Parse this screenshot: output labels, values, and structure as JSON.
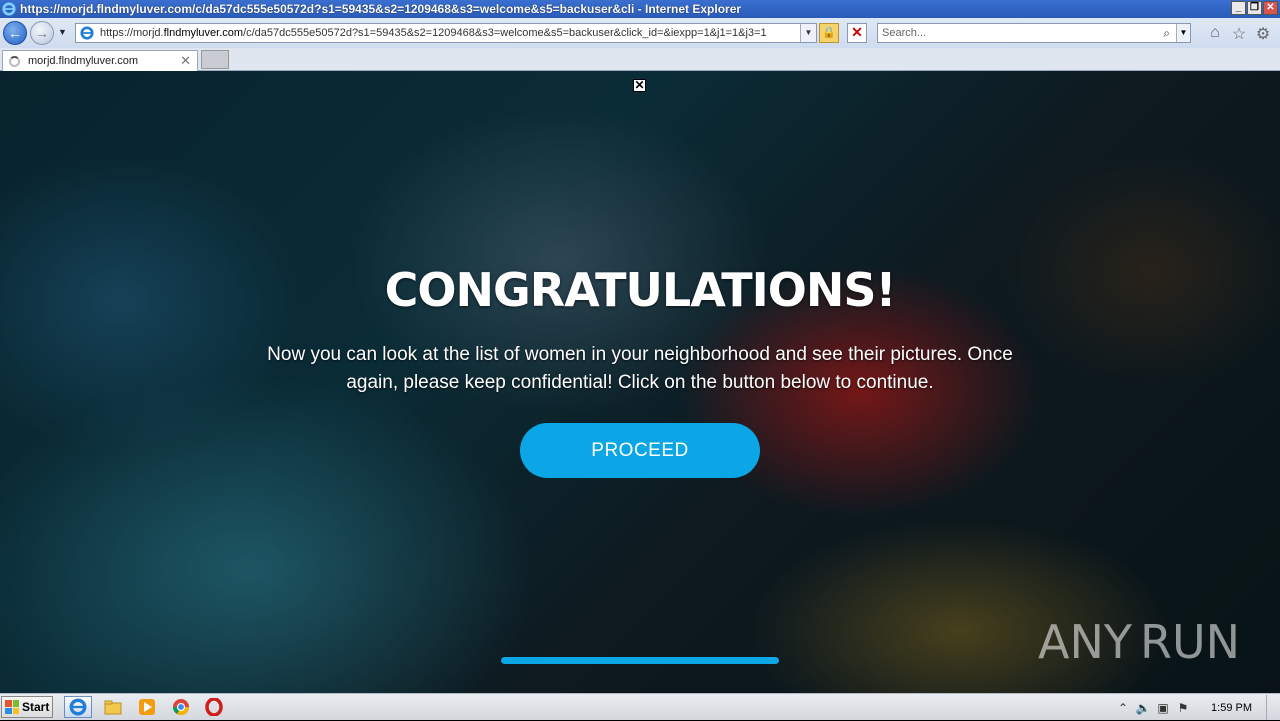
{
  "window": {
    "title": "https://morjd.flndmyluver.com/c/da57dc555e50572d?s1=59435&s2=1209468&s3=welcome&s5=backuser&cli - Internet Explorer",
    "buttons": {
      "minimize": "_",
      "maximize": "❐",
      "close": "✕"
    }
  },
  "navigation": {
    "url_prefix": "https://morjd.",
    "url_domain": "flndmyluver.com",
    "url_rest": "/c/da57dc555e50572d?s1=59435&s2=1209468&s3=welcome&s5=backuser&click_id=&iexpp=1&j1=1&j3=1",
    "search_placeholder": "Search..."
  },
  "tabs": [
    {
      "label": "morjd.flndmyluver.com",
      "loading": true
    }
  ],
  "page": {
    "close_label": "✕",
    "headline": "CONGRATULATIONS!",
    "message": "Now you can look at the list of women in your neighborhood and see their pictures. Once again, please keep confidential! Click on the button below to continue.",
    "button_label": "PROCEED",
    "progress_fraction": 1.0,
    "accent_color": "#0aa6e6"
  },
  "watermark": {
    "left": "ANY",
    "right": "RUN"
  },
  "taskbar": {
    "start_label": "Start",
    "apps": [
      "internet-explorer-icon",
      "file-explorer-icon",
      "media-player-icon",
      "chrome-icon",
      "opera-icon"
    ],
    "clock": "1:59 PM"
  }
}
